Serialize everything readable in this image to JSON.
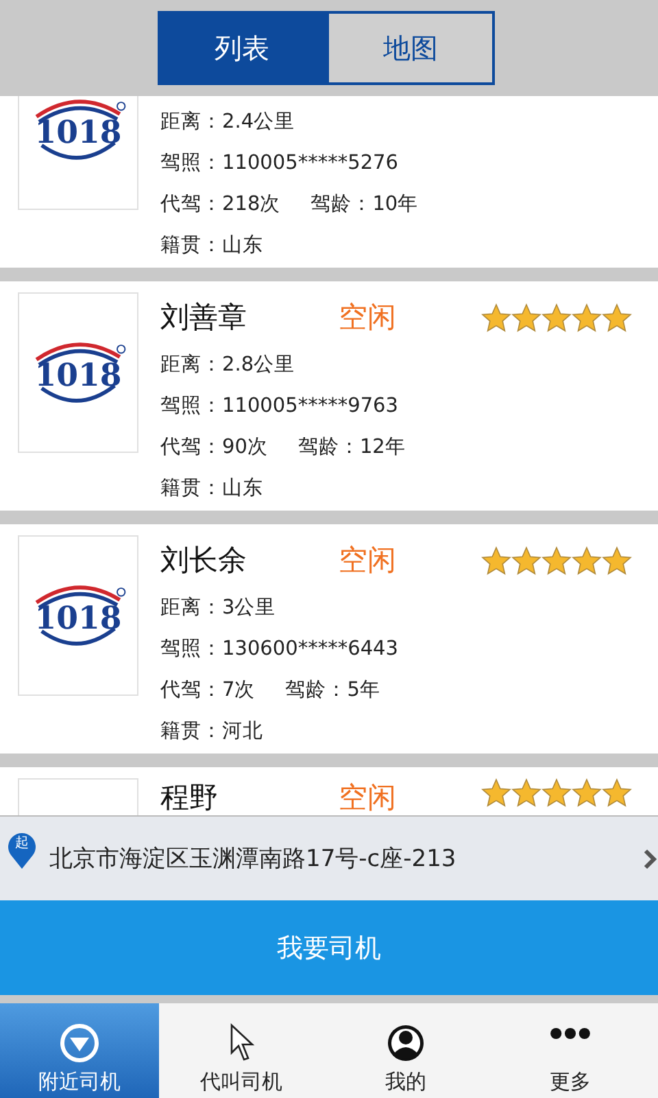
{
  "tabs": [
    {
      "label": "列表",
      "selected": true
    },
    {
      "label": "地图",
      "selected": false
    }
  ],
  "drivers": [
    {
      "logo_text": "1018",
      "distance": "距离：2.4公里",
      "license": "驾照：110005*****5276",
      "trips": "代驾：218次",
      "years": "驾龄：10年",
      "hometown": "籍贯：山东"
    },
    {
      "name": "刘善章",
      "status": "空闲",
      "stars": 5,
      "logo_text": "1018",
      "distance": "距离：2.8公里",
      "license": "驾照：110005*****9763",
      "trips": "代驾：90次",
      "years": "驾龄：12年",
      "hometown": "籍贯：山东"
    },
    {
      "name": "刘长余",
      "status": "空闲",
      "stars": 5,
      "logo_text": "1018",
      "distance": "距离：3公里",
      "license": "驾照：130600*****6443",
      "trips": "代驾：7次",
      "years": "驾龄：5年",
      "hometown": "籍贯：河北"
    },
    {
      "name": "程野",
      "status": "空闲",
      "stars": 5
    }
  ],
  "address": {
    "pin_label": "起",
    "text": "北京市海淀区玉渊潭南路17号-c座-213"
  },
  "request_button": "我要司机",
  "nav": [
    {
      "kind": "nearby",
      "label": "附近司机",
      "selected": true
    },
    {
      "kind": "call",
      "label": "代叫司机",
      "selected": false
    },
    {
      "kind": "mine",
      "label": "我的",
      "selected": false
    },
    {
      "kind": "more",
      "label": "更多",
      "selected": false
    }
  ]
}
